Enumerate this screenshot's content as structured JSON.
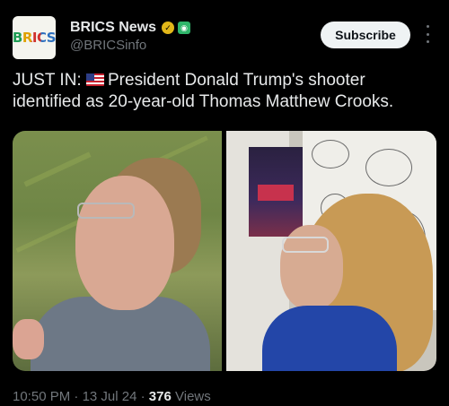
{
  "account": {
    "avatar_text": "BRICS",
    "name": "BRICS News",
    "handle": "@BRICSinfo",
    "avatar_colors": [
      "#1f9d55",
      "#e0a100",
      "#d0312d",
      "#2c6fbe"
    ]
  },
  "header": {
    "subscribe_label": "Subscribe",
    "verified_badge_icon": "gold-verified-badge-icon",
    "affiliate_badge_icon": "affiliate-badge-icon"
  },
  "tweet": {
    "text_prefix": "JUST IN:",
    "flag_icon": "us-flag-icon",
    "text_body": "President Donald Trump's shooter identified as 20-year-old Thomas Matthew Crooks."
  },
  "media": {
    "photo_count": 2
  },
  "meta": {
    "time": "10:50 PM",
    "date": "13 Jul 24",
    "views_count": "376",
    "views_label": "Views",
    "separator": "·"
  },
  "colors": {
    "background": "#000000",
    "text_primary": "#e7e9ea",
    "text_secondary": "#71767b",
    "subscribe_bg": "#eff3f4"
  }
}
